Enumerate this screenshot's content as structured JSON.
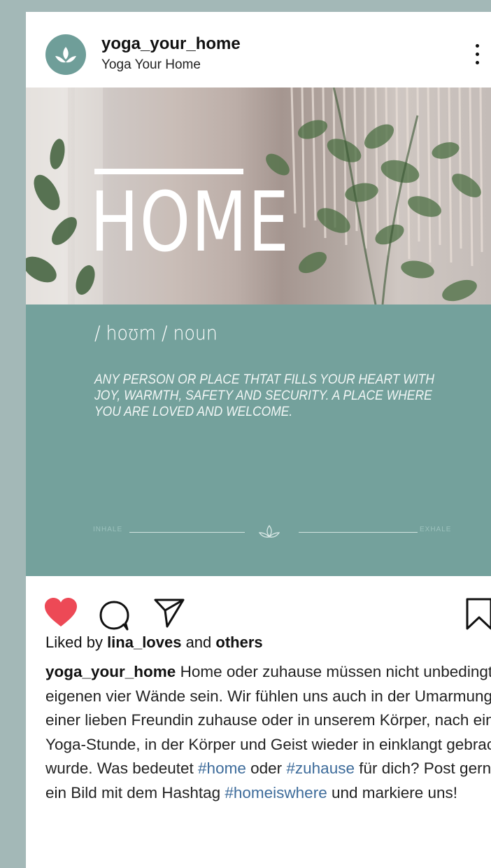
{
  "post": {
    "username": "yoga_your_home",
    "full_name": "Yoga Your Home",
    "image": {
      "title_word": "HOME",
      "phonetic": "/ hoʊm /   noun",
      "definition": "ANY PERSON OR PLACE THTAT FILLS YOUR HEART WITH JOY, WARMTH, SAFETY AND SECURITY. A PLACE WHERE YOU ARE LOVED AND WELCOME.",
      "inhale_label": "INHALE",
      "exhale_label": "EXHALE",
      "teal_color": "#74a19c"
    },
    "actions": {
      "like_icon": "heart-icon",
      "comment_icon": "comment-icon",
      "share_icon": "send-icon",
      "save_icon": "bookmark-icon",
      "liked": true,
      "like_color": "#ed4956"
    },
    "likes": {
      "prefix": "Liked by ",
      "user": "lina_loves",
      "middle": " and ",
      "others": "others"
    },
    "caption": {
      "author": "yoga_your_home",
      "text_1": " Home oder zuhause müssen nicht unbedingt die eigenen vier Wände sein. Wir fühlen uns auch in der Umarmung einer lieben Freundin zuhause oder in unserem Körper, nach einer Yoga-Stunde, in der Körper und Geist wieder in einklangt gebracht wurde. Was bedeutet ",
      "hashtag_1": "#home",
      "text_2": " oder ",
      "hashtag_2": "#zuhause",
      "text_3": " für dich? Post gerne ein Bild mit dem Hashtag ",
      "hashtag_3": "#homeiswhere",
      "text_4": " und markiere uns!"
    }
  }
}
